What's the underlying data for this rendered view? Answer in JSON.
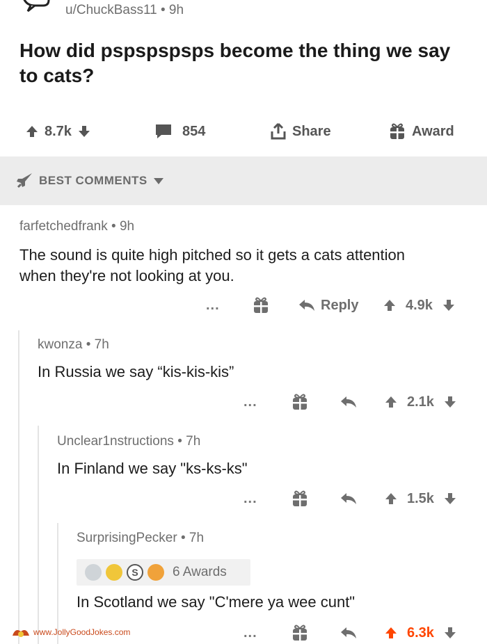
{
  "post": {
    "author": "u/ChuckBass11",
    "age": "9h",
    "title": "How did pspspspsps become the thing we say to cats?",
    "votes": "8.7k",
    "comments": "854",
    "share_label": "Share",
    "award_label": "Award"
  },
  "sort": {
    "label": "BEST COMMENTS"
  },
  "comments": [
    {
      "author": "farfetchedfrank",
      "age": "9h",
      "body": "The sound is quite high pitched so it gets a cats attention when they're not looking at you.",
      "reply_label": "Reply",
      "votes": "4.9k",
      "more": "..."
    },
    {
      "author": "kwonza",
      "age": "7h",
      "body": "In Russia we say “kis-kis-kis”",
      "votes": "2.1k",
      "more": "..."
    },
    {
      "author": "Unclear1nstructions",
      "age": "7h",
      "body": "In Finland we say \"ks-ks-ks\"",
      "votes": "1.5k",
      "more": "..."
    },
    {
      "author": "SurprisingPecker",
      "age": "7h",
      "awards_label": "6 Awards",
      "body": "In Scotland we say \"C'mere ya wee cunt\"",
      "votes": "6.3k",
      "more": "..."
    }
  ],
  "watermark": "www.JollyGoodJokes.com",
  "colors": {
    "upvoted": "#ff4500",
    "muted": "#6e6e6e",
    "bar": "#ececec"
  },
  "icons": [
    "speech-bubble-icon",
    "upvote-icon",
    "downvote-icon",
    "comment-icon",
    "share-icon",
    "gift-icon",
    "rocket-icon",
    "caret-down-icon",
    "reply-arrow-icon",
    "more-icon"
  ]
}
